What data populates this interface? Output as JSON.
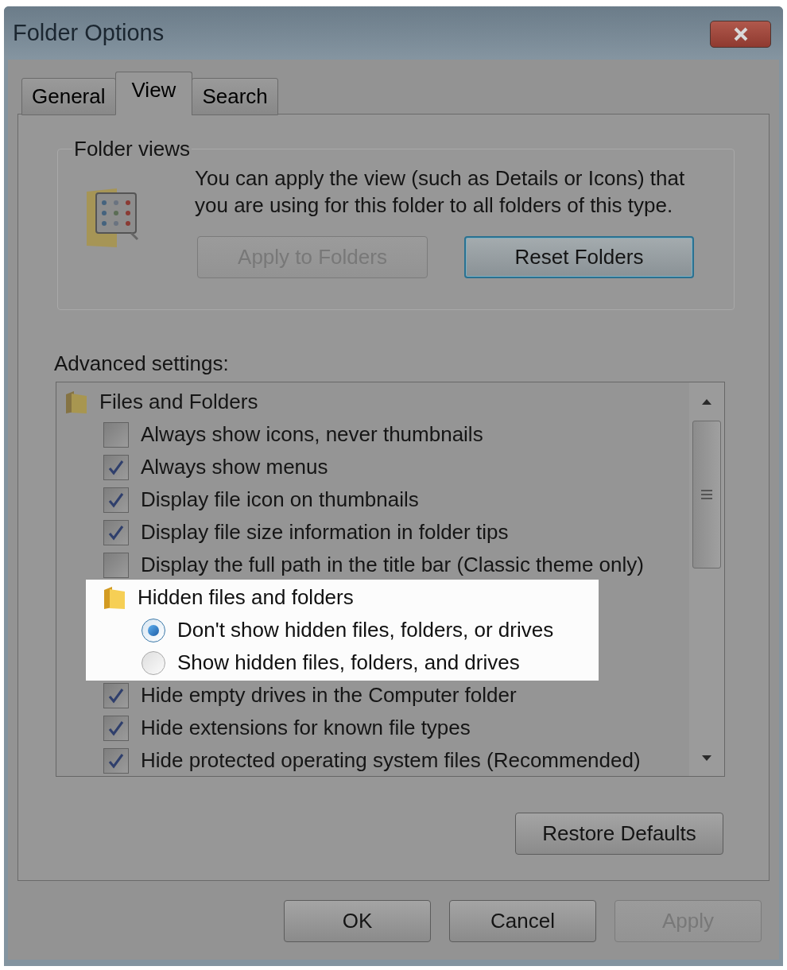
{
  "window": {
    "title": "Folder Options"
  },
  "tabs": [
    {
      "label": "General",
      "selected": false
    },
    {
      "label": "View",
      "selected": true
    },
    {
      "label": "Search",
      "selected": false
    }
  ],
  "folder_views": {
    "title": "Folder views",
    "description": "You can apply the view (such as Details or Icons) that you are using for this folder to all folders of this type.",
    "buttons": [
      {
        "label": "Apply to Folders",
        "disabled": true,
        "focused": false
      },
      {
        "label": "Reset Folders",
        "disabled": false,
        "focused": true
      }
    ]
  },
  "advanced_settings": {
    "label": "Advanced settings:",
    "items": [
      {
        "kind": "group",
        "label": "Files and Folders",
        "highlighted": false,
        "children": [
          {
            "kind": "checkbox",
            "label": "Always show icons, never thumbnails",
            "checked": false
          },
          {
            "kind": "checkbox",
            "label": "Always show menus",
            "checked": true
          },
          {
            "kind": "checkbox",
            "label": "Display file icon on thumbnails",
            "checked": true
          },
          {
            "kind": "checkbox",
            "label": "Display file size information in folder tips",
            "checked": true
          },
          {
            "kind": "checkbox",
            "label": "Display the full path in the title bar (Classic theme only)",
            "checked": false
          },
          {
            "kind": "group",
            "label": "Hidden files and folders",
            "highlighted": true,
            "children": [
              {
                "kind": "radio",
                "label": "Don't show hidden files, folders, or drives",
                "selected": true
              },
              {
                "kind": "radio",
                "label": "Show hidden files, folders, and drives",
                "selected": false
              }
            ]
          },
          {
            "kind": "checkbox",
            "label": "Hide empty drives in the Computer folder",
            "checked": true
          },
          {
            "kind": "checkbox",
            "label": "Hide extensions for known file types",
            "checked": true
          },
          {
            "kind": "checkbox",
            "label": "Hide protected operating system files (Recommended)",
            "checked": true
          }
        ]
      }
    ],
    "restore_button": {
      "label": "Restore Defaults",
      "disabled": false
    }
  },
  "buttons": [
    {
      "label": "OK",
      "disabled": false
    },
    {
      "label": "Cancel",
      "disabled": false
    },
    {
      "label": "Apply",
      "disabled": true
    }
  ]
}
